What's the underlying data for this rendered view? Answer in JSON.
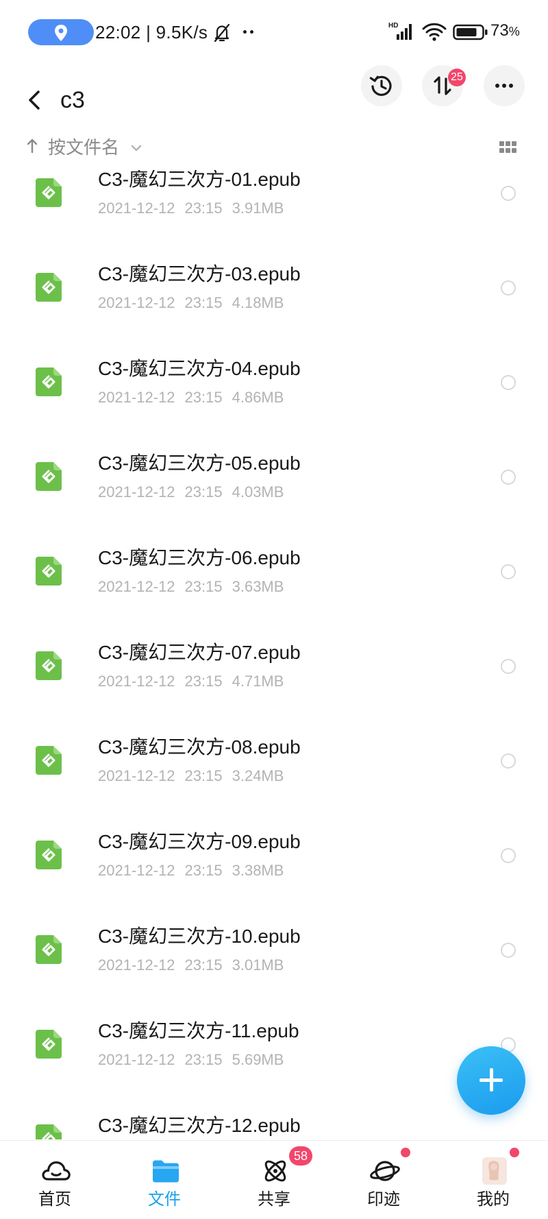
{
  "status_bar": {
    "time_speed": "22:02 | 9.5K/s",
    "battery_pct": "73",
    "battery_unit": "%",
    "icons": [
      "location-icon",
      "bell-muted-icon",
      "more-dots-icon",
      "hd-signal-icon",
      "wifi-icon",
      "battery-icon"
    ]
  },
  "header": {
    "title": "c3",
    "transfer_badge": "25",
    "icons": [
      "back-icon",
      "history-icon",
      "transfer-icon",
      "more-icon"
    ]
  },
  "sort": {
    "label": "按文件名",
    "icons": [
      "sort-up-arrow-icon",
      "chevron-down-icon",
      "grid-view-icon"
    ]
  },
  "files": [
    {
      "name": "C3-魔幻三次方-01.epub",
      "date": "2021-12-12",
      "time": "23:15",
      "size": "3.91MB"
    },
    {
      "name": "C3-魔幻三次方-03.epub",
      "date": "2021-12-12",
      "time": "23:15",
      "size": "4.18MB"
    },
    {
      "name": "C3-魔幻三次方-04.epub",
      "date": "2021-12-12",
      "time": "23:15",
      "size": "4.86MB"
    },
    {
      "name": "C3-魔幻三次方-05.epub",
      "date": "2021-12-12",
      "time": "23:15",
      "size": "4.03MB"
    },
    {
      "name": "C3-魔幻三次方-06.epub",
      "date": "2021-12-12",
      "time": "23:15",
      "size": "3.63MB"
    },
    {
      "name": "C3-魔幻三次方-07.epub",
      "date": "2021-12-12",
      "time": "23:15",
      "size": "4.71MB"
    },
    {
      "name": "C3-魔幻三次方-08.epub",
      "date": "2021-12-12",
      "time": "23:15",
      "size": "3.24MB"
    },
    {
      "name": "C3-魔幻三次方-09.epub",
      "date": "2021-12-12",
      "time": "23:15",
      "size": "3.38MB"
    },
    {
      "name": "C3-魔幻三次方-10.epub",
      "date": "2021-12-12",
      "time": "23:15",
      "size": "3.01MB"
    },
    {
      "name": "C3-魔幻三次方-11.epub",
      "date": "2021-12-12",
      "time": "23:15",
      "size": "5.69MB"
    },
    {
      "name": "C3-魔幻三次方-12.epub",
      "date": "",
      "time": "",
      "size": ""
    }
  ],
  "fab": {
    "icon": "plus-icon"
  },
  "bottom_nav": {
    "items": [
      {
        "label": "首页",
        "icon": "home-cloud-icon",
        "active": false,
        "badge": ""
      },
      {
        "label": "文件",
        "icon": "folder-icon",
        "active": true,
        "badge": ""
      },
      {
        "label": "共享",
        "icon": "share-atom-icon",
        "active": false,
        "badge": "58"
      },
      {
        "label": "印迹",
        "icon": "planet-icon",
        "active": false,
        "badge": "dot"
      },
      {
        "label": "我的",
        "icon": "avatar-icon",
        "active": false,
        "badge": "dot"
      }
    ]
  },
  "colors": {
    "accent": "#1aa0f0",
    "badge": "#f2466b",
    "file_icon": "#6cc04a",
    "location_pill": "#4f8ef7"
  }
}
